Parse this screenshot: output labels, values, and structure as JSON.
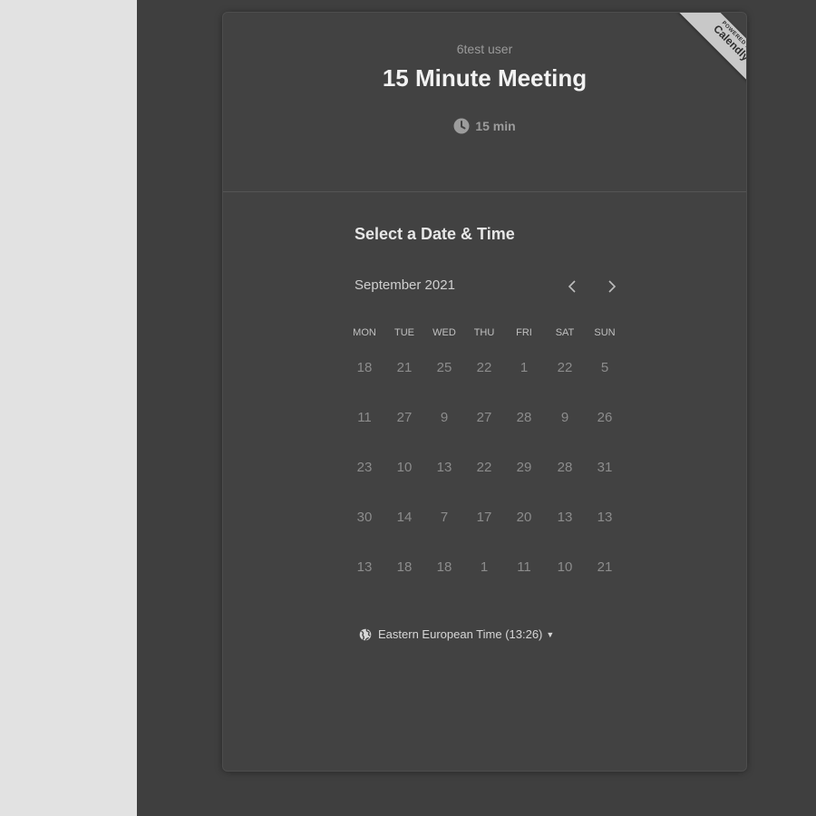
{
  "header": {
    "host_name": "6test user",
    "event_title": "15 Minute Meeting",
    "duration": "15 min"
  },
  "badge": {
    "powered_by": "POWERED BY",
    "brand": "Calendly"
  },
  "scheduler": {
    "section_title": "Select a Date & Time",
    "month_label": "September 2021",
    "prev_icon": "chevron-left-icon",
    "next_icon": "chevron-right-icon",
    "weekdays": [
      "MON",
      "TUE",
      "WED",
      "THU",
      "FRI",
      "SAT",
      "SUN"
    ],
    "weeks": [
      [
        "18",
        "21",
        "25",
        "22",
        "1",
        "22",
        "5"
      ],
      [
        "11",
        "27",
        "9",
        "27",
        "28",
        "9",
        "26"
      ],
      [
        "23",
        "10",
        "13",
        "22",
        "29",
        "28",
        "31"
      ],
      [
        "30",
        "14",
        "7",
        "17",
        "20",
        "13",
        "13"
      ],
      [
        "13",
        "18",
        "18",
        "1",
        "11",
        "10",
        "21"
      ]
    ],
    "timezone": "Eastern European Time (13:26)"
  },
  "colors": {
    "left_panel": "#e2e2e2",
    "page_background": "#3f3f3f",
    "card_background": "#424242",
    "badge_background": "#c8c8c8"
  }
}
